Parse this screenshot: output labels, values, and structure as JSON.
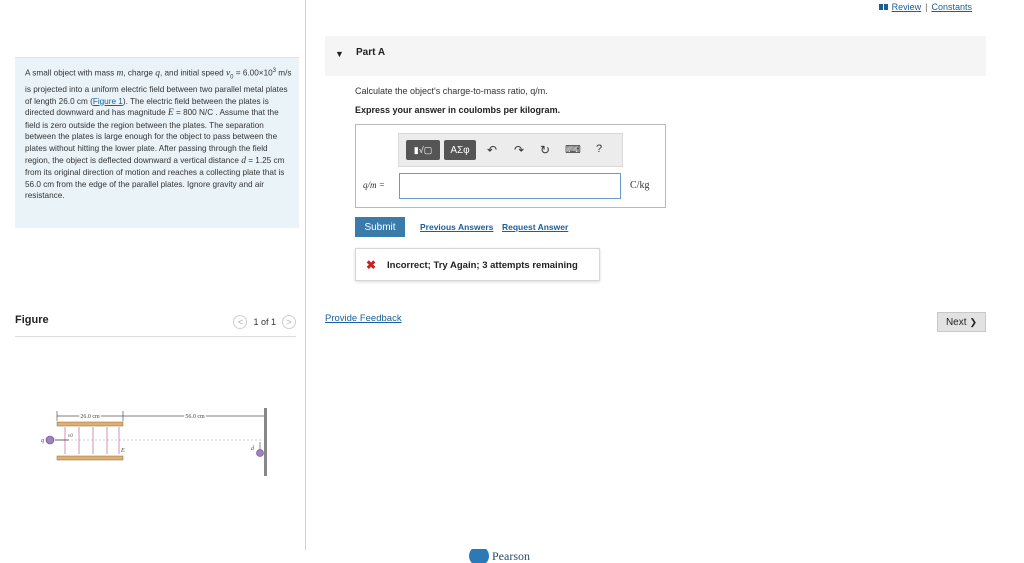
{
  "header": {
    "review_label": "Review",
    "separator": "|",
    "constants_label": "Constants"
  },
  "problem": {
    "text_1": "A small object with mass ",
    "m": "m",
    "text_2": ", charge ",
    "q": "q",
    "text_3": ", and initial speed ",
    "v0": "v",
    "v0_sub": "0",
    "text_4": " = 6.00×10",
    "exp": "3",
    "text_5": " m/s is projected into a uniform electric field between two parallel metal plates of length 26.0 cm (",
    "figure_link": "Figure 1",
    "text_6": "). The electric field between the plates is directed downward and has magnitude ",
    "E": "E",
    "text_7": " = 800 N/C . Assume that the field is zero outside the region between the plates. The separation between the plates is large enough for the object to pass between the plates without hitting the lower plate. After passing through the field region, the object is deflected downward a vertical distance ",
    "d": "d",
    "text_8": " = 1.25 cm from its original direction of motion and reaches a collecting plate that is 56.0 cm from the edge of the parallel plates. Ignore gravity and air resistance."
  },
  "figure_panel": {
    "title": "Figure",
    "page": "1 of 1",
    "prev": "<",
    "next": ">",
    "labels": {
      "plate_length": "26.0 cm",
      "distance": "56.0 cm",
      "q": "q",
      "v0": "v0",
      "E": "E",
      "d": "d"
    }
  },
  "part": {
    "label": "Part A",
    "question": "Calculate the object's charge-to-mass ratio, q/m.",
    "instruction": "Express your answer in coulombs per kilogram.",
    "eq_label": "q/m =",
    "unit": "C/kg",
    "input_value": "",
    "toolbar": {
      "templates": "▮√▢",
      "greek": "ΑΣφ",
      "undo": "↶",
      "redo": "↷",
      "reset": "↻",
      "keyboard": "⌨",
      "help": "?"
    }
  },
  "actions": {
    "submit": "Submit",
    "previous_answers": "Previous Answers",
    "request_answer": "Request Answer"
  },
  "feedback": {
    "icon": "✖",
    "message": "Incorrect; Try Again; 3 attempts remaining"
  },
  "footer": {
    "provide_feedback": "Provide Feedback",
    "next": "Next",
    "next_chevron": "❯",
    "brand": "Pearson"
  },
  "colors": {
    "accent": "#3a7bac",
    "link": "#1a5e9a",
    "error": "#cc2222",
    "problem_bg": "#eaf4f8"
  }
}
